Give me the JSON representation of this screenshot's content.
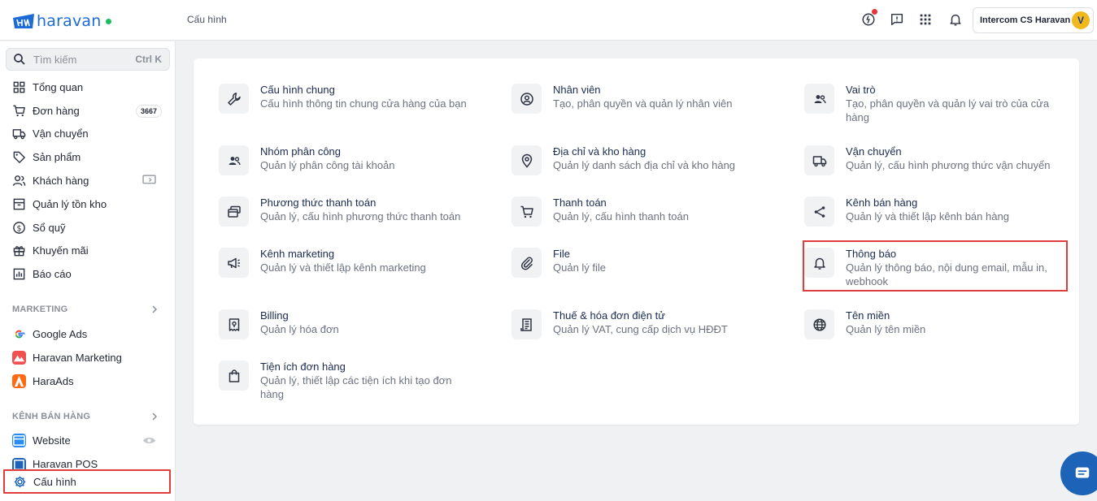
{
  "brand": {
    "name": "haravan",
    "status_color": "#1bbf5a",
    "accent": "#1d6bd6"
  },
  "header": {
    "breadcrumb": "Cấu hình",
    "icons": [
      "help-sync-icon",
      "feedback-icon",
      "apps-grid-icon",
      "bell-icon"
    ],
    "account_name": "Intercom CS Haravan",
    "avatar_initial": "V"
  },
  "sidebar": {
    "search_placeholder": "Tìm kiếm",
    "search_shortcut": "Ctrl K",
    "items": [
      {
        "label": "Tổng quan",
        "icon": "dashboard-icon"
      },
      {
        "label": "Đơn hàng",
        "icon": "cart-icon",
        "badge": "3667"
      },
      {
        "label": "Vận chuyển",
        "icon": "truck-icon"
      },
      {
        "label": "Sản phẩm",
        "icon": "tag-icon"
      },
      {
        "label": "Khách hàng",
        "icon": "users-icon"
      },
      {
        "label": "Quản lý tồn kho",
        "icon": "inventory-icon"
      },
      {
        "label": "Sổ quỹ",
        "icon": "cashbook-icon"
      },
      {
        "label": "Khuyến mãi",
        "icon": "gift-icon"
      },
      {
        "label": "Báo cáo",
        "icon": "report-icon"
      }
    ],
    "marketing_title": "MARKETING",
    "marketing_items": [
      {
        "label": "Google Ads",
        "icon": "google-icon"
      },
      {
        "label": "Haravan Marketing",
        "icon": "haravan-marketing-icon"
      },
      {
        "label": "HaraAds",
        "icon": "haraads-icon"
      }
    ],
    "channels_title": "KÊNH BÁN HÀNG",
    "channel_items": [
      {
        "label": "Website",
        "icon": "website-icon"
      },
      {
        "label": "Haravan POS",
        "icon": "pos-icon"
      }
    ],
    "settings_label": "Cấu hình"
  },
  "settings": [
    {
      "title": "Cấu hình chung",
      "desc": "Cấu hình thông tin chung cửa hàng của bạn",
      "icon": "wrench-icon"
    },
    {
      "title": "Nhân viên",
      "desc": "Tạo, phân quyền và quản lý nhân viên",
      "icon": "user-circle-icon"
    },
    {
      "title": "Vai trò",
      "desc": "Tạo, phân quyền và quản lý vai trò của cửa hàng",
      "icon": "roles-icon"
    },
    {
      "title": "Nhóm phân công",
      "desc": "Quản lý phân công tài khoản",
      "icon": "group-icon"
    },
    {
      "title": "Địa chỉ và kho hàng",
      "desc": "Quản lý danh sách địa chỉ và kho hàng",
      "icon": "location-pin-icon"
    },
    {
      "title": "Vận chuyển",
      "desc": "Quản lý, cấu hình phương thức vận chuyển",
      "icon": "truck-icon"
    },
    {
      "title": "Phương thức thanh toán",
      "desc": "Quản lý, cấu hình phương thức thanh toán",
      "icon": "payment-cards-icon"
    },
    {
      "title": "Thanh toán",
      "desc": "Quản lý, cấu hình thanh toán",
      "icon": "cart-icon"
    },
    {
      "title": "Kênh bán hàng",
      "desc": "Quản lý và thiết lập kênh bán hàng",
      "icon": "share-icon"
    },
    {
      "title": "Kênh marketing",
      "desc": "Quản lý và thiết lập kênh marketing",
      "icon": "megaphone-icon"
    },
    {
      "title": "File",
      "desc": "Quản lý file",
      "icon": "paperclip-icon"
    },
    {
      "title": "Thông báo",
      "desc": "Quản lý thông báo, nội dung email, mẫu in, webhook",
      "icon": "bell-icon"
    },
    {
      "title": "Billing",
      "desc": "Quản lý hóa đơn",
      "icon": "billing-icon"
    },
    {
      "title": "Thuế & hóa đơn điện tử",
      "desc": "Quản lý VAT, cung cấp dịch vụ HĐĐT",
      "icon": "invoice-icon"
    },
    {
      "title": "Tên miền",
      "desc": "Quản lý tên miền",
      "icon": "globe-icon"
    },
    {
      "title": "Tiện ích đơn hàng",
      "desc": "Quản lý, thiết lập các tiện ích khi tạo đơn hàng",
      "icon": "shopping-bag-icon"
    }
  ],
  "chat_button_icon": "chat-icon",
  "highlight_color": "#e03c3c"
}
